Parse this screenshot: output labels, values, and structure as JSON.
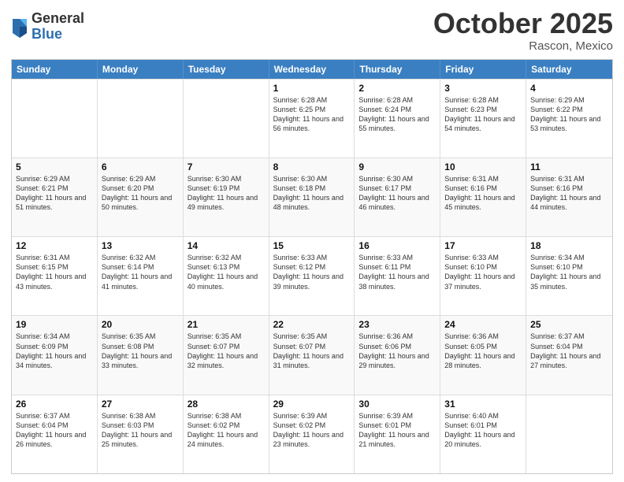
{
  "logo": {
    "general": "General",
    "blue": "Blue"
  },
  "header": {
    "month": "October 2025",
    "location": "Rascon, Mexico"
  },
  "days": [
    "Sunday",
    "Monday",
    "Tuesday",
    "Wednesday",
    "Thursday",
    "Friday",
    "Saturday"
  ],
  "weeks": [
    [
      {
        "day": "",
        "sunrise": "",
        "sunset": "",
        "daylight": ""
      },
      {
        "day": "",
        "sunrise": "",
        "sunset": "",
        "daylight": ""
      },
      {
        "day": "",
        "sunrise": "",
        "sunset": "",
        "daylight": ""
      },
      {
        "day": "1",
        "sunrise": "Sunrise: 6:28 AM",
        "sunset": "Sunset: 6:25 PM",
        "daylight": "Daylight: 11 hours and 56 minutes."
      },
      {
        "day": "2",
        "sunrise": "Sunrise: 6:28 AM",
        "sunset": "Sunset: 6:24 PM",
        "daylight": "Daylight: 11 hours and 55 minutes."
      },
      {
        "day": "3",
        "sunrise": "Sunrise: 6:28 AM",
        "sunset": "Sunset: 6:23 PM",
        "daylight": "Daylight: 11 hours and 54 minutes."
      },
      {
        "day": "4",
        "sunrise": "Sunrise: 6:29 AM",
        "sunset": "Sunset: 6:22 PM",
        "daylight": "Daylight: 11 hours and 53 minutes."
      }
    ],
    [
      {
        "day": "5",
        "sunrise": "Sunrise: 6:29 AM",
        "sunset": "Sunset: 6:21 PM",
        "daylight": "Daylight: 11 hours and 51 minutes."
      },
      {
        "day": "6",
        "sunrise": "Sunrise: 6:29 AM",
        "sunset": "Sunset: 6:20 PM",
        "daylight": "Daylight: 11 hours and 50 minutes."
      },
      {
        "day": "7",
        "sunrise": "Sunrise: 6:30 AM",
        "sunset": "Sunset: 6:19 PM",
        "daylight": "Daylight: 11 hours and 49 minutes."
      },
      {
        "day": "8",
        "sunrise": "Sunrise: 6:30 AM",
        "sunset": "Sunset: 6:18 PM",
        "daylight": "Daylight: 11 hours and 48 minutes."
      },
      {
        "day": "9",
        "sunrise": "Sunrise: 6:30 AM",
        "sunset": "Sunset: 6:17 PM",
        "daylight": "Daylight: 11 hours and 46 minutes."
      },
      {
        "day": "10",
        "sunrise": "Sunrise: 6:31 AM",
        "sunset": "Sunset: 6:16 PM",
        "daylight": "Daylight: 11 hours and 45 minutes."
      },
      {
        "day": "11",
        "sunrise": "Sunrise: 6:31 AM",
        "sunset": "Sunset: 6:16 PM",
        "daylight": "Daylight: 11 hours and 44 minutes."
      }
    ],
    [
      {
        "day": "12",
        "sunrise": "Sunrise: 6:31 AM",
        "sunset": "Sunset: 6:15 PM",
        "daylight": "Daylight: 11 hours and 43 minutes."
      },
      {
        "day": "13",
        "sunrise": "Sunrise: 6:32 AM",
        "sunset": "Sunset: 6:14 PM",
        "daylight": "Daylight: 11 hours and 41 minutes."
      },
      {
        "day": "14",
        "sunrise": "Sunrise: 6:32 AM",
        "sunset": "Sunset: 6:13 PM",
        "daylight": "Daylight: 11 hours and 40 minutes."
      },
      {
        "day": "15",
        "sunrise": "Sunrise: 6:33 AM",
        "sunset": "Sunset: 6:12 PM",
        "daylight": "Daylight: 11 hours and 39 minutes."
      },
      {
        "day": "16",
        "sunrise": "Sunrise: 6:33 AM",
        "sunset": "Sunset: 6:11 PM",
        "daylight": "Daylight: 11 hours and 38 minutes."
      },
      {
        "day": "17",
        "sunrise": "Sunrise: 6:33 AM",
        "sunset": "Sunset: 6:10 PM",
        "daylight": "Daylight: 11 hours and 37 minutes."
      },
      {
        "day": "18",
        "sunrise": "Sunrise: 6:34 AM",
        "sunset": "Sunset: 6:10 PM",
        "daylight": "Daylight: 11 hours and 35 minutes."
      }
    ],
    [
      {
        "day": "19",
        "sunrise": "Sunrise: 6:34 AM",
        "sunset": "Sunset: 6:09 PM",
        "daylight": "Daylight: 11 hours and 34 minutes."
      },
      {
        "day": "20",
        "sunrise": "Sunrise: 6:35 AM",
        "sunset": "Sunset: 6:08 PM",
        "daylight": "Daylight: 11 hours and 33 minutes."
      },
      {
        "day": "21",
        "sunrise": "Sunrise: 6:35 AM",
        "sunset": "Sunset: 6:07 PM",
        "daylight": "Daylight: 11 hours and 32 minutes."
      },
      {
        "day": "22",
        "sunrise": "Sunrise: 6:35 AM",
        "sunset": "Sunset: 6:07 PM",
        "daylight": "Daylight: 11 hours and 31 minutes."
      },
      {
        "day": "23",
        "sunrise": "Sunrise: 6:36 AM",
        "sunset": "Sunset: 6:06 PM",
        "daylight": "Daylight: 11 hours and 29 minutes."
      },
      {
        "day": "24",
        "sunrise": "Sunrise: 6:36 AM",
        "sunset": "Sunset: 6:05 PM",
        "daylight": "Daylight: 11 hours and 28 minutes."
      },
      {
        "day": "25",
        "sunrise": "Sunrise: 6:37 AM",
        "sunset": "Sunset: 6:04 PM",
        "daylight": "Daylight: 11 hours and 27 minutes."
      }
    ],
    [
      {
        "day": "26",
        "sunrise": "Sunrise: 6:37 AM",
        "sunset": "Sunset: 6:04 PM",
        "daylight": "Daylight: 11 hours and 26 minutes."
      },
      {
        "day": "27",
        "sunrise": "Sunrise: 6:38 AM",
        "sunset": "Sunset: 6:03 PM",
        "daylight": "Daylight: 11 hours and 25 minutes."
      },
      {
        "day": "28",
        "sunrise": "Sunrise: 6:38 AM",
        "sunset": "Sunset: 6:02 PM",
        "daylight": "Daylight: 11 hours and 24 minutes."
      },
      {
        "day": "29",
        "sunrise": "Sunrise: 6:39 AM",
        "sunset": "Sunset: 6:02 PM",
        "daylight": "Daylight: 11 hours and 23 minutes."
      },
      {
        "day": "30",
        "sunrise": "Sunrise: 6:39 AM",
        "sunset": "Sunset: 6:01 PM",
        "daylight": "Daylight: 11 hours and 21 minutes."
      },
      {
        "day": "31",
        "sunrise": "Sunrise: 6:40 AM",
        "sunset": "Sunset: 6:01 PM",
        "daylight": "Daylight: 11 hours and 20 minutes."
      },
      {
        "day": "",
        "sunrise": "",
        "sunset": "",
        "daylight": ""
      }
    ]
  ]
}
